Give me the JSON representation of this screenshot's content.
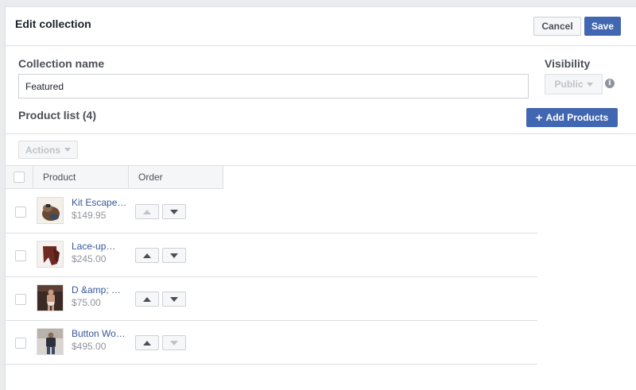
{
  "header": {
    "title": "Edit collection",
    "cancel_label": "Cancel",
    "save_label": "Save"
  },
  "form": {
    "collection_name_label": "Collection name",
    "collection_name_value": "Featured",
    "visibility_label": "Visibility",
    "visibility_value": "Public"
  },
  "product_list": {
    "title": "Product list (4)",
    "add_label": "Add Products",
    "actions_label": "Actions",
    "columns": [
      "Product",
      "Order"
    ],
    "rows": [
      {
        "name": "Kit Escape…",
        "price": "$149.95",
        "up_disabled": true,
        "down_disabled": false
      },
      {
        "name": "Lace-up…",
        "price": "$245.00",
        "up_disabled": false,
        "down_disabled": false
      },
      {
        "name": "D &amp; …",
        "price": "$75.00",
        "up_disabled": false,
        "down_disabled": false
      },
      {
        "name": "Button Wo…",
        "price": "$495.00",
        "up_disabled": false,
        "down_disabled": true
      }
    ]
  },
  "colors": {
    "accent": "#4267b2",
    "link": "#365899",
    "muted": "#90949c",
    "border": "#dddfe2"
  }
}
